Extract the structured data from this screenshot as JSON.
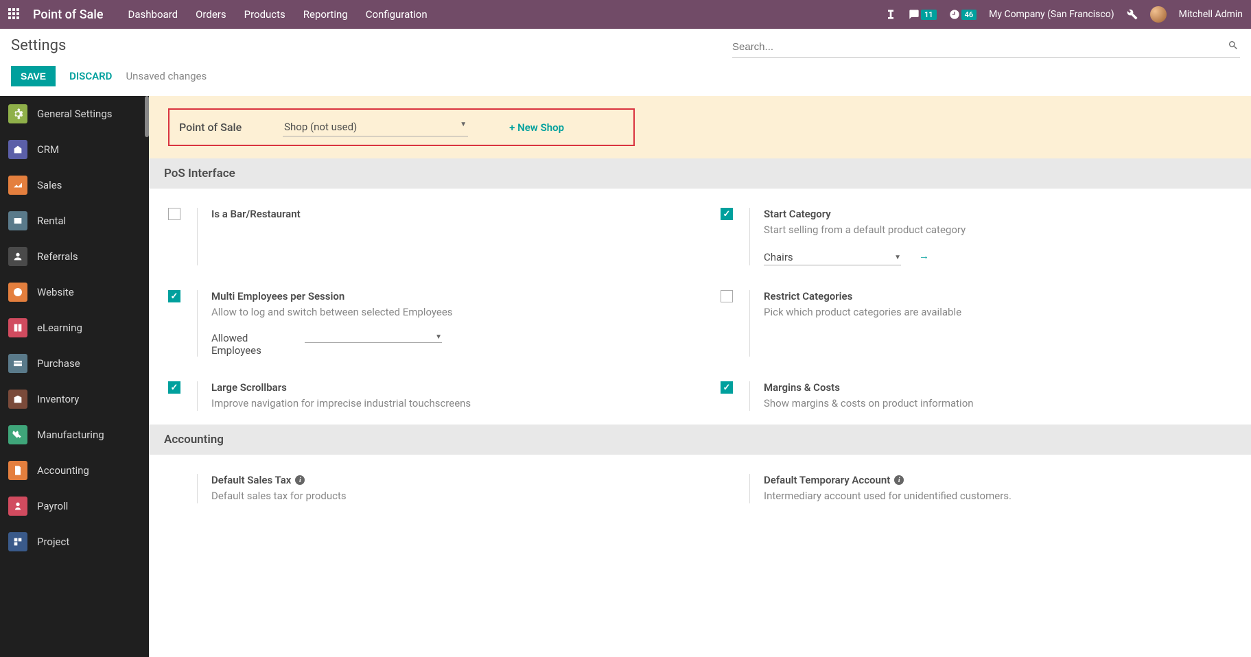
{
  "navbar": {
    "app_title": "Point of Sale",
    "menu": [
      "Dashboard",
      "Orders",
      "Products",
      "Reporting",
      "Configuration"
    ],
    "messages_count": "11",
    "activities_count": "46",
    "company": "My Company (San Francisco)",
    "user": "Mitchell Admin"
  },
  "header": {
    "title": "Settings",
    "search_placeholder": "Search..."
  },
  "actions": {
    "save": "SAVE",
    "discard": "DISCARD",
    "status": "Unsaved changes"
  },
  "sidebar": {
    "items": [
      {
        "label": "General Settings"
      },
      {
        "label": "CRM"
      },
      {
        "label": "Sales"
      },
      {
        "label": "Rental"
      },
      {
        "label": "Referrals"
      },
      {
        "label": "Website"
      },
      {
        "label": "eLearning"
      },
      {
        "label": "Purchase"
      },
      {
        "label": "Inventory"
      },
      {
        "label": "Manufacturing"
      },
      {
        "label": "Accounting"
      },
      {
        "label": "Payroll"
      },
      {
        "label": "Project"
      }
    ]
  },
  "pos_header": {
    "label": "Point of Sale",
    "shop_value": "Shop (not used)",
    "new_shop": "+ New Shop"
  },
  "sections": {
    "interface": "PoS Interface",
    "accounting": "Accounting"
  },
  "settings": {
    "bar": {
      "title": "Is a Bar/Restaurant"
    },
    "start_cat": {
      "title": "Start Category",
      "desc": "Start selling from a default product category",
      "value": "Chairs"
    },
    "multi_emp": {
      "title": "Multi Employees per Session",
      "desc": "Allow to log and switch between selected Employees",
      "sub_label": "Allowed Employees"
    },
    "restrict": {
      "title": "Restrict Categories",
      "desc": "Pick which product categories are available"
    },
    "scrollbars": {
      "title": "Large Scrollbars",
      "desc": "Improve navigation for imprecise industrial touchscreens"
    },
    "margins": {
      "title": "Margins & Costs",
      "desc": "Show margins & costs on product information"
    },
    "sales_tax": {
      "title": "Default Sales Tax",
      "desc": "Default sales tax for products"
    },
    "temp_acc": {
      "title": "Default Temporary Account",
      "desc": "Intermediary account used for unidentified customers."
    }
  }
}
